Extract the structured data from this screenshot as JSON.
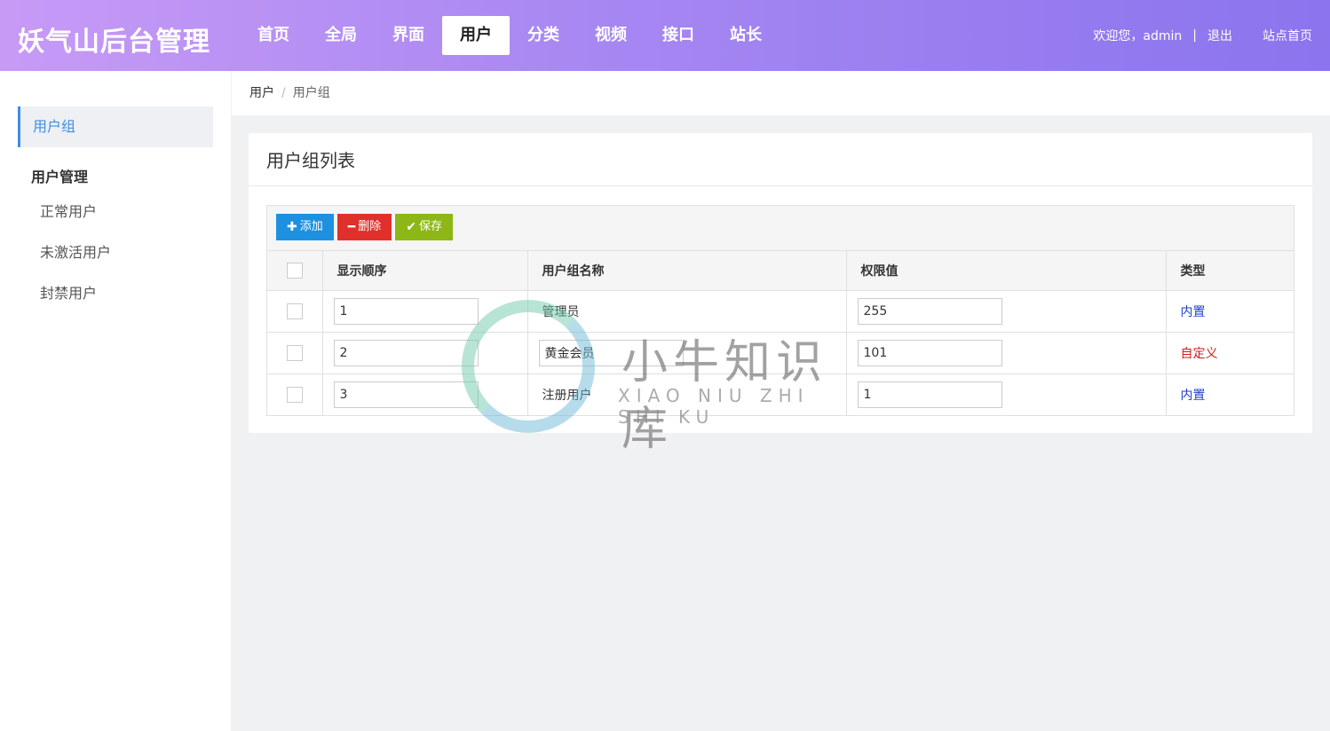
{
  "header": {
    "logo": "妖气山后台管理",
    "nav": [
      {
        "label": "首页"
      },
      {
        "label": "全局"
      },
      {
        "label": "界面"
      },
      {
        "label": "用户",
        "active": true
      },
      {
        "label": "分类"
      },
      {
        "label": "视频"
      },
      {
        "label": "接口"
      },
      {
        "label": "站长"
      }
    ],
    "welcome": "欢迎您，admin",
    "separator": "|",
    "logout": "退出",
    "site_home": "站点首页"
  },
  "sidebar": {
    "active_item": "用户组",
    "group_title": "用户管理",
    "items": [
      "正常用户",
      "未激活用户",
      "封禁用户"
    ]
  },
  "breadcrumb": {
    "root": "用户",
    "separator": "/",
    "current": "用户组"
  },
  "card": {
    "title": "用户组列表",
    "toolbar": {
      "add": "添加",
      "delete": "删除",
      "save": "保存"
    },
    "columns": [
      "显示顺序",
      "用户组名称",
      "权限值",
      "类型"
    ],
    "rows": [
      {
        "order": "1",
        "name": "管理员",
        "name_editable": false,
        "permission": "255",
        "type": "内置",
        "type_kind": "builtin"
      },
      {
        "order": "2",
        "name": "黄金会员",
        "name_editable": true,
        "permission": "101",
        "type": "自定义",
        "type_kind": "custom"
      },
      {
        "order": "3",
        "name": "注册用户",
        "name_editable": false,
        "permission": "1",
        "type": "内置",
        "type_kind": "builtin"
      }
    ]
  },
  "watermark": {
    "text": "小牛知识库",
    "sub": "XIAO NIU ZHI SHI KU"
  },
  "colors": {
    "header_gradient_start": "#c79af6",
    "header_gradient_end": "#8b74ee",
    "accent": "#3d8ee6",
    "btn_add": "#1e90e0",
    "btn_delete": "#e0302c",
    "btn_save": "#8db717",
    "type_builtin": "#1e3fcf",
    "type_custom": "#d8181a"
  }
}
